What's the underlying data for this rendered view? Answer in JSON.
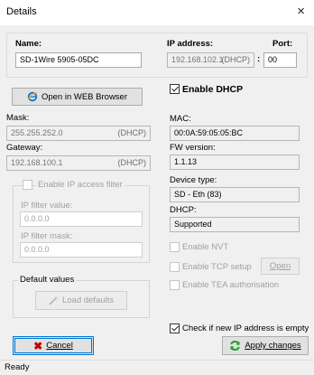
{
  "window": {
    "title": "Details",
    "close_symbol": "×"
  },
  "name": {
    "label": "Name:",
    "value": "SD-1Wire 5905-05DC"
  },
  "ip": {
    "label": "IP address:",
    "value": "192.168.102.1",
    "tag": "(DHCP)",
    "separator": ":"
  },
  "port": {
    "label": "Port:",
    "value": "00"
  },
  "open_browser": {
    "label": "Open in WEB Browser",
    "icon": "internet-explorer-icon"
  },
  "enable_dhcp": {
    "label": "Enable DHCP",
    "checked": true
  },
  "mask": {
    "label": "Mask:",
    "value": "255.255.252.0",
    "tag": "(DHCP)"
  },
  "gateway": {
    "label": "Gateway:",
    "value": "192.168.100.1",
    "tag": "(DHCP)"
  },
  "mac": {
    "label": "MAC:",
    "value": "00:0A:59:05:05:BC"
  },
  "fw_version": {
    "label": "FW version:",
    "value": "1.1.13"
  },
  "device_type": {
    "label": "Device type:",
    "value": "SD - Eth (83)"
  },
  "dhcp": {
    "label": "DHCP:",
    "value": "Supported"
  },
  "ip_filter": {
    "enable_label": "Enable IP access filter",
    "value_label": "IP filter value:",
    "value": "0.0.0.0",
    "mask_label": "IP filter mask:",
    "mask": "0.0.0.0"
  },
  "options": {
    "enable_nvt": "Enable NVT",
    "enable_tcp_setup": "Enable TCP setup",
    "open_button": "Open",
    "enable_tea": "Enable TEA authorisation"
  },
  "default_values": {
    "label": "Default values",
    "load_button": "Load defaults"
  },
  "check_empty": {
    "label": "Check if new IP address is empty",
    "checked": true
  },
  "cancel_button": {
    "label": "Cancel",
    "icon": "x-icon",
    "color": "#c00000"
  },
  "apply_button": {
    "label": "Apply changes",
    "icon": "refresh-icon",
    "color": "#1e9e2a"
  },
  "status": {
    "text": "Ready"
  }
}
